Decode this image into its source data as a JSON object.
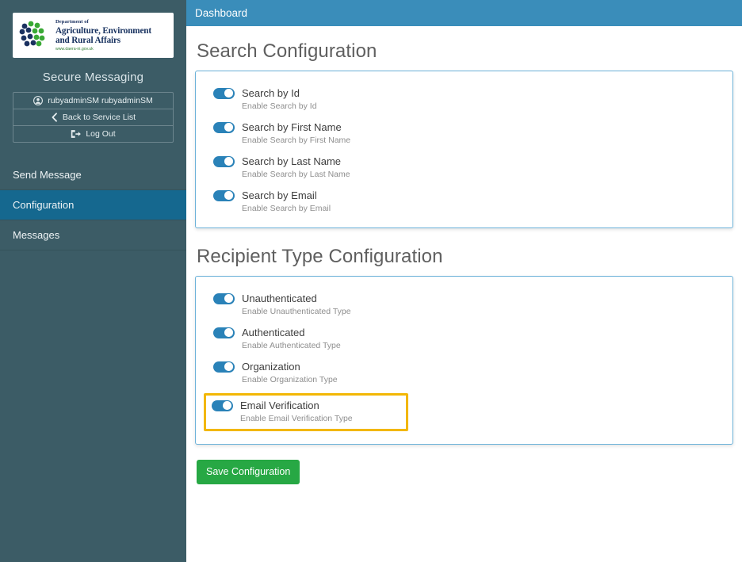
{
  "colors": {
    "sidebar_bg": "#3c5c66",
    "sidebar_active": "#15688f",
    "header_blue": "#3a8dba",
    "card_border": "#6cb2d9",
    "toggle_on": "#2a82b8",
    "highlight": "#f2b705",
    "save_green": "#27a844"
  },
  "sidebar": {
    "logo": {
      "icon": "daera-dots-logo",
      "department_line": "Department of",
      "title_line1": "Agriculture, Environment",
      "title_line2": "and Rural Affairs",
      "url": "www.daera-ni.gov.uk"
    },
    "brand_title": "Secure Messaging",
    "account": [
      {
        "icon": "user-icon",
        "label": "rubyadminSM rubyadminSM"
      },
      {
        "icon": "chevron-left-icon",
        "label": "Back to Service List"
      },
      {
        "icon": "logout-icon",
        "label": "Log Out"
      }
    ],
    "nav": [
      {
        "label": "Send Message",
        "active": false
      },
      {
        "label": "Configuration",
        "active": true
      },
      {
        "label": "Messages",
        "active": false
      }
    ]
  },
  "header": {
    "title": "Dashboard"
  },
  "main": {
    "search_section": {
      "title": "Search Configuration",
      "options": [
        {
          "label": "Search by Id",
          "sub": "Enable Search by Id",
          "on": true
        },
        {
          "label": "Search by First Name",
          "sub": "Enable Search by First Name",
          "on": true
        },
        {
          "label": "Search by Last Name",
          "sub": "Enable Search by Last Name",
          "on": true
        },
        {
          "label": "Search by Email",
          "sub": "Enable Search by Email",
          "on": true
        }
      ]
    },
    "recipient_section": {
      "title": "Recipient Type Configuration",
      "options": [
        {
          "label": "Unauthenticated",
          "sub": "Enable Unauthenticated Type",
          "on": true,
          "highlighted": false
        },
        {
          "label": "Authenticated",
          "sub": "Enable Authenticated Type",
          "on": true,
          "highlighted": false
        },
        {
          "label": "Organization",
          "sub": "Enable Organization Type",
          "on": true,
          "highlighted": false
        },
        {
          "label": "Email Verification",
          "sub": "Enable Email Verification Type",
          "on": true,
          "highlighted": true
        }
      ]
    },
    "save_label": "Save Configuration"
  }
}
